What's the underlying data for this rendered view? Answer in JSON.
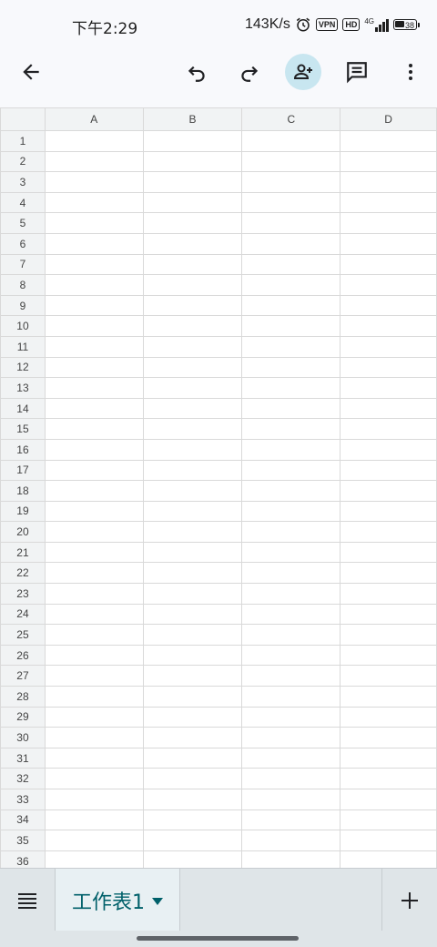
{
  "status_bar": {
    "time": "下午2:29",
    "network_speed": "143K/s",
    "alarm_icon": "alarm-icon",
    "vpn_label": "VPN",
    "hd_label": "HD",
    "signal_label": "4G",
    "battery_level": "38"
  },
  "toolbar": {
    "back_icon": "arrow-back-icon",
    "undo_icon": "undo-icon",
    "redo_icon": "redo-icon",
    "share_icon": "person-add-icon",
    "comment_icon": "comment-icon",
    "more_icon": "more-vert-icon",
    "accent_color": "#c8e6f0"
  },
  "grid": {
    "columns": [
      "A",
      "B",
      "C",
      "D"
    ],
    "rows": [
      "1",
      "2",
      "3",
      "4",
      "5",
      "6",
      "7",
      "8",
      "9",
      "10",
      "11",
      "12",
      "13",
      "14",
      "15",
      "16",
      "17",
      "18",
      "19",
      "20",
      "21",
      "22",
      "23",
      "24",
      "25",
      "26",
      "27",
      "28",
      "29",
      "30",
      "31",
      "32",
      "33",
      "34",
      "35",
      "36"
    ]
  },
  "bottom_bar": {
    "menu_icon": "sheet-list-icon",
    "sheet_name": "工作表1",
    "add_icon": "add-sheet-icon",
    "accent_color": "#00606a"
  }
}
